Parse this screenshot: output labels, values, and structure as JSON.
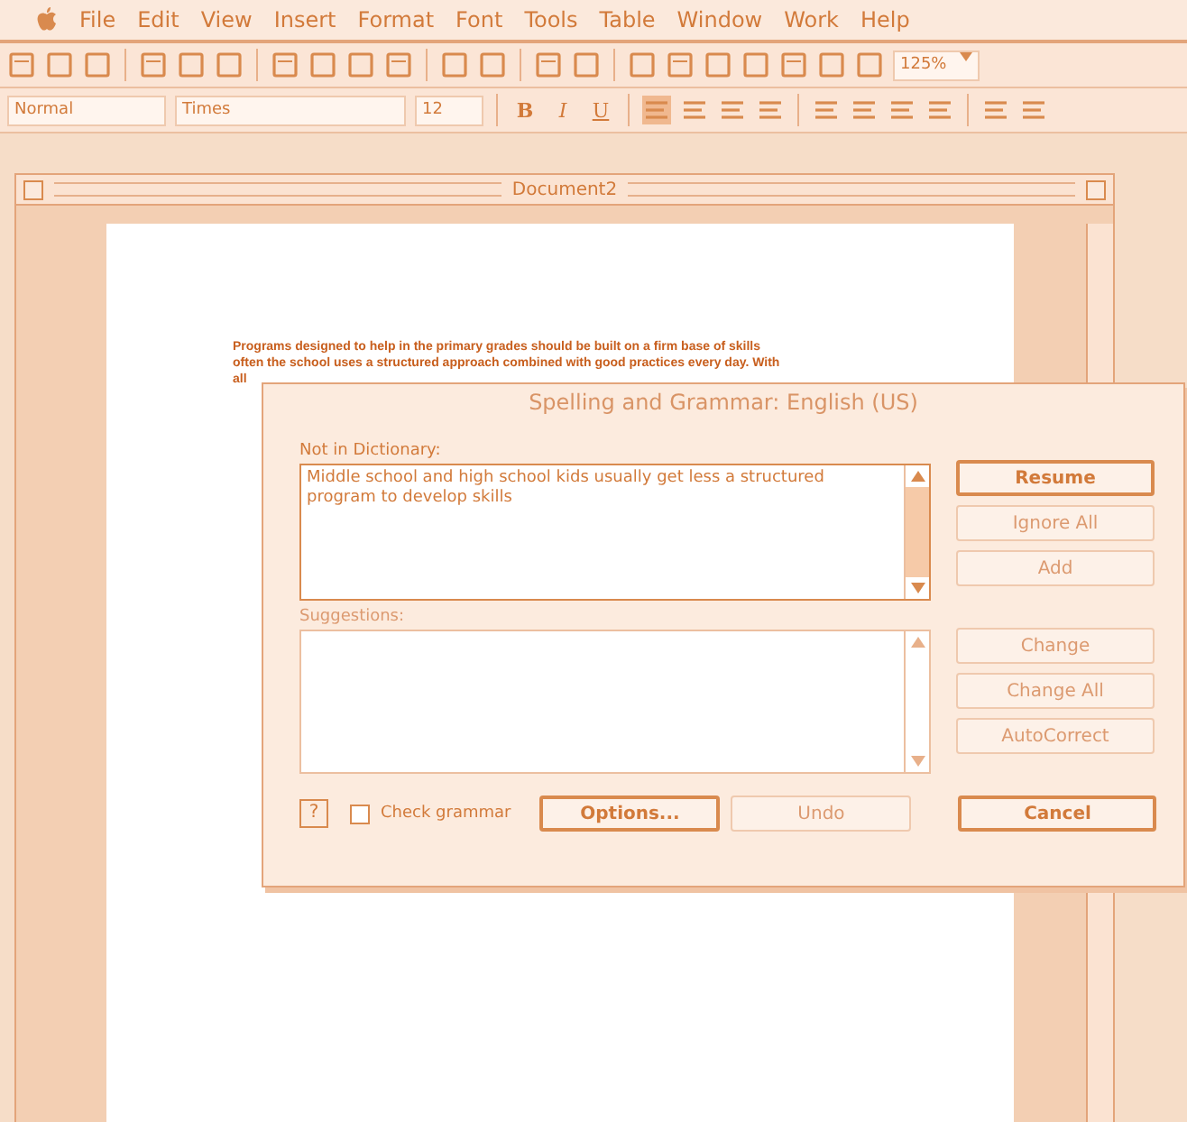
{
  "menu_bar": {
    "items": [
      "File",
      "Edit",
      "View",
      "Insert",
      "Format",
      "Font",
      "Tools",
      "Table",
      "Window",
      "Work",
      "Help"
    ]
  },
  "standard_toolbar": {
    "zoom": "125%"
  },
  "formatting_toolbar": {
    "style": "Normal",
    "font": "Times",
    "size": "12",
    "bold": "B",
    "italic": "I",
    "underline": "U"
  },
  "document_window": {
    "title": "Document2",
    "lines": [
      "Programs designed to help in the primary grades should be built on a firm base of skills",
      "often the school uses a structured approach combined with good practices every day. With",
      "all"
    ]
  },
  "dialog": {
    "title": "Spelling and Grammar: English (US)",
    "not_in_dictionary_label": "Not in Dictionary:",
    "not_in_dictionary_text": "Middle school and high school kids usually get less a structured program to develop skills",
    "suggestions_label": "Suggestions:",
    "buttons": [
      {
        "label": "Resume",
        "disabled": false,
        "default": true
      },
      {
        "label": "Ignore All",
        "disabled": true,
        "default": false
      },
      {
        "label": "Add",
        "disabled": true,
        "default": false
      },
      {
        "label": "Change",
        "disabled": true,
        "default": false
      },
      {
        "label": "Change All",
        "disabled": true,
        "default": false
      },
      {
        "label": "AutoCorrect",
        "disabled": true,
        "default": false
      }
    ],
    "help": "?",
    "check_grammar": {
      "label": "Check grammar",
      "checked": false
    },
    "bottom_buttons": [
      {
        "label": "Options...",
        "disabled": false,
        "default": true
      },
      {
        "label": "Undo",
        "disabled": true,
        "default": false
      },
      {
        "label": "Cancel",
        "disabled": false,
        "default": true
      }
    ]
  }
}
